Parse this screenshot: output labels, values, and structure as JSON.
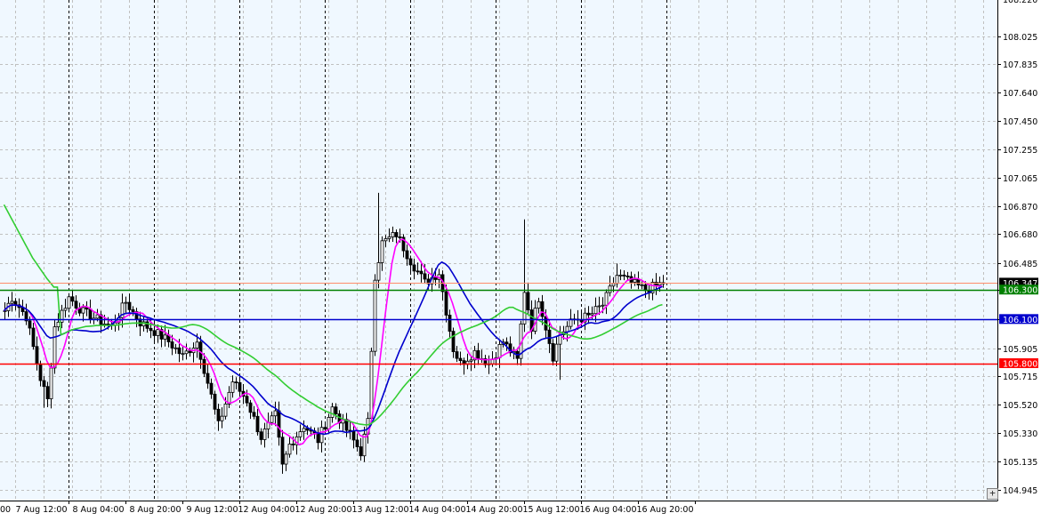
{
  "chart_data": {
    "type": "candlestick",
    "plot_background": "#f0f8ff",
    "grid": "on",
    "grid_color": "#c0c0c0",
    "ylim": [
      104.87,
      108.27
    ],
    "y_ticks": [
      "108.025",
      "107.835",
      "107.640",
      "107.450",
      "107.255",
      "107.065",
      "106.870",
      "106.680",
      "106.485",
      "106.300",
      "106.100",
      "105.905",
      "105.715",
      "105.520",
      "105.330",
      "105.135",
      "104.945"
    ],
    "y_tick_top_partial": "108.220",
    "x_ticks": [
      {
        "label": "7 Aug 12:00",
        "pos": 18
      },
      {
        "label": "8 Aug 04:00",
        "pos": 34
      },
      {
        "label": "8 Aug 20:00",
        "pos": 50
      },
      {
        "label": "9 Aug 12:00",
        "pos": 66
      },
      {
        "label": "12 Aug 04:00",
        "pos": 82
      },
      {
        "label": "12 Aug 20:00",
        "pos": 98
      },
      {
        "label": "13 Aug 12:00",
        "pos": 114
      },
      {
        "label": "14 Aug 04:00",
        "pos": 130
      },
      {
        "label": "14 Aug 20:00",
        "pos": 146
      },
      {
        "label": "15 Aug 12:00",
        "pos": 162
      },
      {
        "label": "16 Aug 04:00",
        "pos": 178
      },
      {
        "label": "16 Aug 20:00",
        "pos": 194
      }
    ],
    "x_tick_left_partial": "00",
    "session_separators": [
      18,
      42,
      66,
      90,
      114,
      138,
      162,
      186
    ],
    "bar_count": 186,
    "candle_color": "#000000",
    "anchors": [
      [
        0,
        106.16
      ],
      [
        2,
        106.25
      ],
      [
        6,
        106.12
      ],
      [
        10,
        105.7
      ],
      [
        12,
        105.55
      ],
      [
        14,
        106.05
      ],
      [
        18,
        106.25
      ],
      [
        22,
        106.15
      ],
      [
        26,
        106.1
      ],
      [
        30,
        106.05
      ],
      [
        34,
        106.22
      ],
      [
        38,
        106.08
      ],
      [
        42,
        106.02
      ],
      [
        46,
        105.95
      ],
      [
        50,
        105.85
      ],
      [
        54,
        105.95
      ],
      [
        58,
        105.58
      ],
      [
        60,
        105.38
      ],
      [
        64,
        105.68
      ],
      [
        68,
        105.55
      ],
      [
        72,
        105.3
      ],
      [
        76,
        105.45
      ],
      [
        78,
        105.1
      ],
      [
        80,
        105.25
      ],
      [
        84,
        105.38
      ],
      [
        88,
        105.28
      ],
      [
        92,
        105.5
      ],
      [
        96,
        105.35
      ],
      [
        100,
        105.2
      ],
      [
        102,
        105.4
      ],
      [
        104,
        106.4
      ],
      [
        106,
        106.62
      ],
      [
        110,
        106.68
      ],
      [
        114,
        106.5
      ],
      [
        118,
        106.35
      ],
      [
        122,
        106.42
      ],
      [
        126,
        105.9
      ],
      [
        128,
        105.8
      ],
      [
        132,
        105.88
      ],
      [
        136,
        105.8
      ],
      [
        140,
        105.95
      ],
      [
        144,
        105.82
      ],
      [
        146,
        106.3
      ],
      [
        148,
        106.05
      ],
      [
        150,
        106.25
      ],
      [
        152,
        106.05
      ],
      [
        154,
        105.85
      ],
      [
        156,
        106.0
      ],
      [
        160,
        106.1
      ],
      [
        164,
        106.12
      ],
      [
        168,
        106.2
      ],
      [
        172,
        106.4
      ],
      [
        176,
        106.35
      ],
      [
        180,
        106.3
      ],
      [
        185,
        106.35
      ]
    ],
    "spikes": [
      {
        "i": 105,
        "high": 106.96
      },
      {
        "i": 146,
        "high": 106.78
      },
      {
        "i": 172,
        "high": 106.48
      },
      {
        "i": 156,
        "low": 105.69
      },
      {
        "i": 11,
        "low": 105.5
      },
      {
        "i": 79,
        "low": 105.07
      }
    ],
    "series": [
      {
        "name": "",
        "color": "#ff00ff",
        "smoothing": 7
      },
      {
        "name": "",
        "color": "#0000cd",
        "smoothing": 20
      },
      {
        "name": "",
        "color": "#32cd32",
        "smoothing": 40
      }
    ],
    "ma_green_start": [
      [
        0,
        106.88
      ],
      [
        4,
        106.7
      ],
      [
        8,
        106.52
      ],
      [
        12,
        106.38
      ],
      [
        14,
        106.32
      ]
    ],
    "horizontal_levels": [
      {
        "value": 106.347,
        "label": "106.347",
        "color": "#ff8c69",
        "label_bg": "#000000",
        "label_color": "#ffffff"
      },
      {
        "value": 106.3,
        "label": "106.300",
        "color": "#008000",
        "label_bg": "#008000",
        "label_color": "#ffffff"
      },
      {
        "value": 106.1,
        "label": "106.100",
        "color": "#0000cd",
        "label_bg": "#0000cd",
        "label_color": "#ffffff"
      },
      {
        "value": 105.8,
        "label": "105.800",
        "color": "#ff0000",
        "label_bg": "#ff0000",
        "label_color": "#ffffff"
      }
    ],
    "corner_button_label": "+"
  }
}
